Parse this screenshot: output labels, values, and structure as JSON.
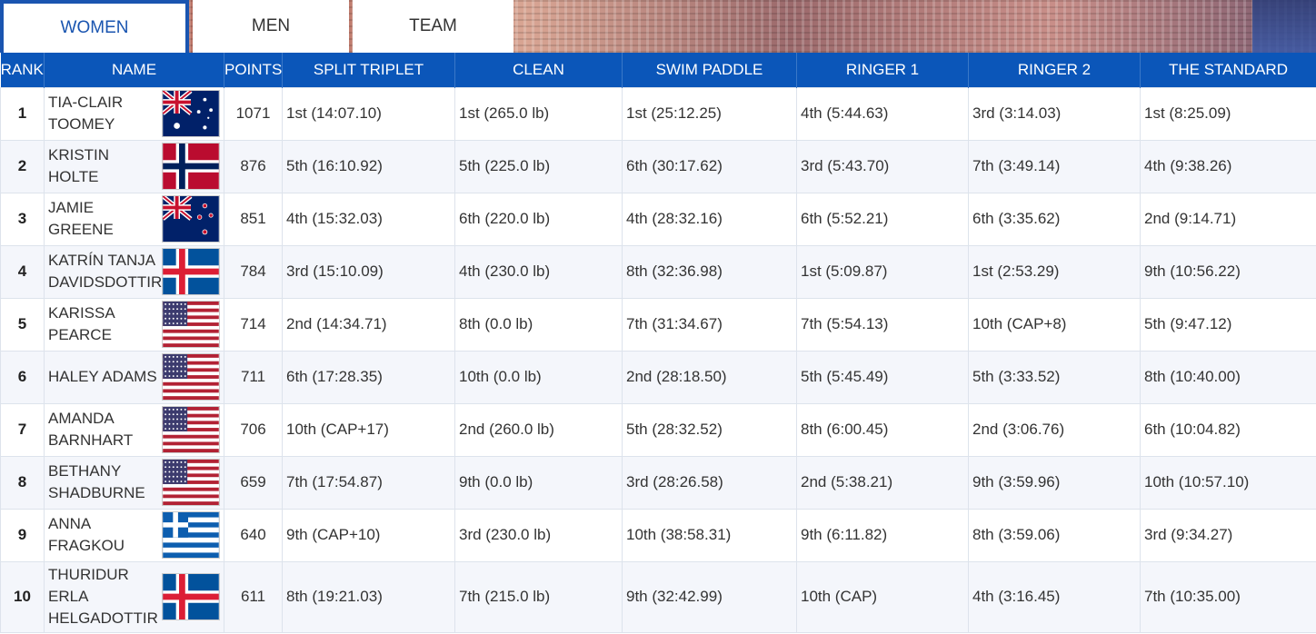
{
  "tabs": [
    {
      "label": "WOMEN",
      "active": true
    },
    {
      "label": "MEN",
      "active": false
    },
    {
      "label": "TEAM",
      "active": false
    }
  ],
  "columns": [
    "RANK",
    "NAME",
    "POINTS",
    "SPLIT TRIPLET",
    "CLEAN",
    "SWIM PADDLE",
    "RINGER 1",
    "RINGER 2",
    "THE STANDARD"
  ],
  "rows": [
    {
      "rank": "1",
      "name": "TIA-CLAIR TOOMEY",
      "flag": "australia-flag",
      "points": "1071",
      "results": [
        "1st (14:07.10)",
        "1st (265.0 lb)",
        "1st (25:12.25)",
        "4th (5:44.63)",
        "3rd (3:14.03)",
        "1st (8:25.09)"
      ]
    },
    {
      "rank": "2",
      "name": "KRISTIN HOLTE",
      "flag": "norway-flag",
      "points": "876",
      "results": [
        "5th (16:10.92)",
        "5th (225.0 lb)",
        "6th (30:17.62)",
        "3rd (5:43.70)",
        "7th (3:49.14)",
        "4th (9:38.26)"
      ]
    },
    {
      "rank": "3",
      "name": "JAMIE GREENE",
      "flag": "new-zealand-flag",
      "points": "851",
      "results": [
        "4th (15:32.03)",
        "6th (220.0 lb)",
        "4th (28:32.16)",
        "6th (5:52.21)",
        "6th (3:35.62)",
        "2nd (9:14.71)"
      ]
    },
    {
      "rank": "4",
      "name": "KATRÍN TANJA DAVIDSDOTTIR",
      "flag": "iceland-flag",
      "points": "784",
      "results": [
        "3rd (15:10.09)",
        "4th (230.0 lb)",
        "8th (32:36.98)",
        "1st (5:09.87)",
        "1st (2:53.29)",
        "9th (10:56.22)"
      ]
    },
    {
      "rank": "5",
      "name": "KARISSA PEARCE",
      "flag": "usa-flag",
      "points": "714",
      "results": [
        "2nd (14:34.71)",
        "8th (0.0 lb)",
        "7th (31:34.67)",
        "7th (5:54.13)",
        "10th (CAP+8)",
        "5th (9:47.12)"
      ]
    },
    {
      "rank": "6",
      "name": "HALEY ADAMS",
      "flag": "usa-flag",
      "points": "711",
      "results": [
        "6th (17:28.35)",
        "10th (0.0 lb)",
        "2nd (28:18.50)",
        "5th (5:45.49)",
        "5th (3:33.52)",
        "8th (10:40.00)"
      ]
    },
    {
      "rank": "7",
      "name": "AMANDA BARNHART",
      "flag": "usa-flag",
      "points": "706",
      "results": [
        "10th (CAP+17)",
        "2nd (260.0 lb)",
        "5th (28:32.52)",
        "8th (6:00.45)",
        "2nd (3:06.76)",
        "6th (10:04.82)"
      ]
    },
    {
      "rank": "8",
      "name": "BETHANY SHADBURNE",
      "flag": "usa-flag",
      "points": "659",
      "results": [
        "7th (17:54.87)",
        "9th (0.0 lb)",
        "3rd (28:26.58)",
        "2nd (5:38.21)",
        "9th (3:59.96)",
        "10th (10:57.10)"
      ]
    },
    {
      "rank": "9",
      "name": "ANNA FRAGKOU",
      "flag": "greece-flag",
      "points": "640",
      "results": [
        "9th (CAP+10)",
        "3rd (230.0 lb)",
        "10th (38:58.31)",
        "9th (6:11.82)",
        "8th (3:59.06)",
        "3rd (9:34.27)"
      ]
    },
    {
      "rank": "10",
      "name": "THURIDUR ERLA HELGADOTTIR",
      "flag": "iceland-flag",
      "points": "611",
      "results": [
        "8th (19:21.03)",
        "7th (215.0 lb)",
        "9th (32:42.99)",
        "10th (CAP)",
        "4th (3:16.45)",
        "7th (10:35.00)"
      ]
    }
  ]
}
